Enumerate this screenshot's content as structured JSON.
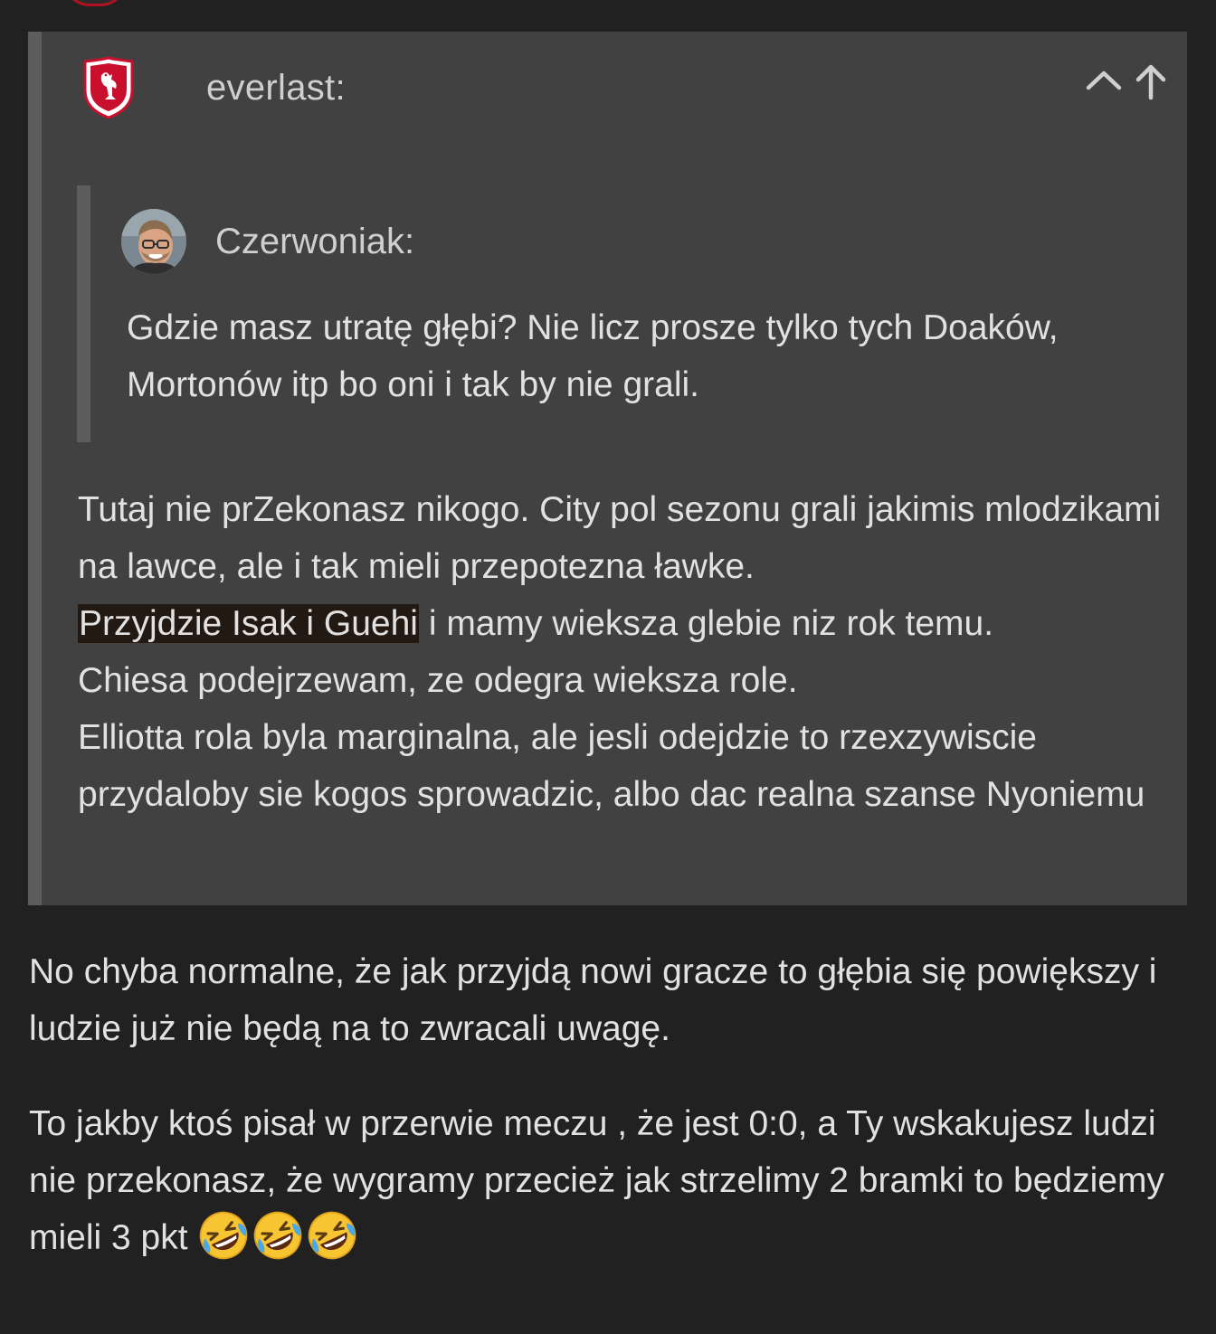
{
  "quote": {
    "author": "everlast:",
    "inner_quote": {
      "author": "Czerwoniak:",
      "text": "Gdzie masz utratę głębi? Nie licz prosze tylko tych Doaków, Mortonów itp bo oni i tak by nie grali."
    },
    "body": {
      "paragraph_1": "Tutaj nie prZekonasz nikogo. City pol sezonu grali jakimis mlodzikami na lawce, ale i tak mieli przepotezna ławke.",
      "highlight": "Przyjdzie Isak i Guehi",
      "after_highlight": " i mamy wieksza glebie niz rok temu.",
      "line_chiesa": "Chiesa podejrzewam, ze odegra wieksza role.",
      "paragraph_elliott": "Elliotta rola byla marginalna, ale jesli odejdzie to rzexzywiscie przydaloby sie kogos sprowadzic, albo dac realna szanse Nyoniemu"
    },
    "controls": {
      "collapse_icon": "chevron-up-icon",
      "jump_icon": "arrow-up-icon"
    }
  },
  "reply": {
    "paragraph_1": "No chyba normalne, że jak przyjdą nowi gracze to głębia się powiększy i ludzie już nie będą na to zwracali uwagę.",
    "paragraph_2": "To jakby ktoś pisał w przerwie meczu , że jest 0:0, a Ty wskakujesz ludzi nie przekonasz, że wygramy przecież jak strzelimy 2 bramki to będziemy mieli 3 pkt",
    "emoji": [
      "rolling-on-floor-laughing",
      "rolling-on-floor-laughing",
      "rolling-on-floor-laughing"
    ]
  },
  "colors": {
    "page_background": "#212121",
    "quote_background": "#414141",
    "quote_border": "#5d5d5d",
    "highlight_background": "#221a12",
    "text": "#e1e1e1",
    "club_red": "#c8102e"
  }
}
